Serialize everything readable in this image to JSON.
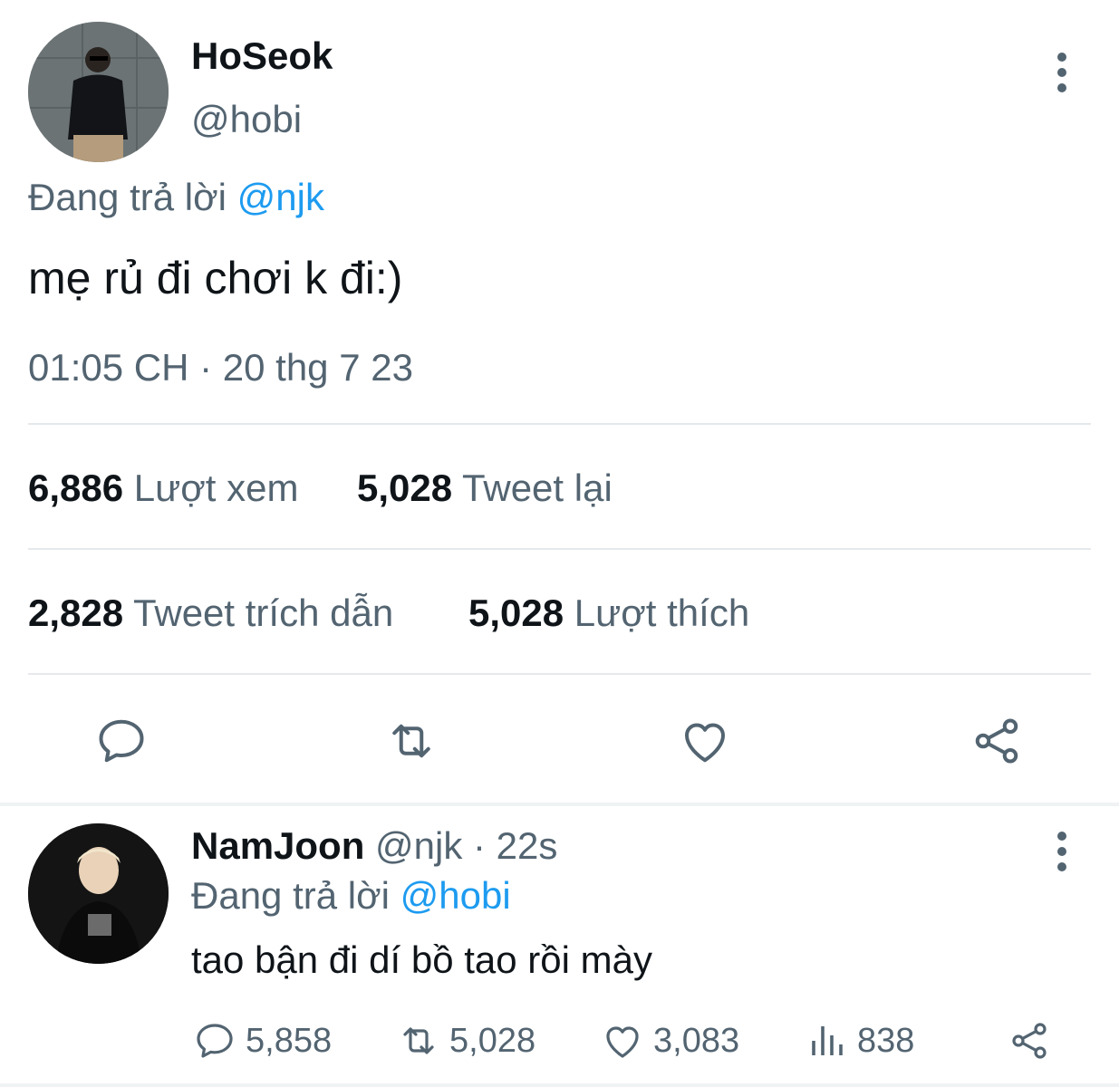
{
  "main_tweet": {
    "name": "HoSeok",
    "handle": "@hobi",
    "replying_prefix": "Đang trả lời",
    "replying_to": "@njk",
    "text": "mẹ rủ đi chơi k đi:)",
    "timestamp": "01:05 CH · 20 thg 7 23",
    "stats": {
      "views_count": "6,886",
      "views_label": "Lượt xem",
      "retweets_count": "5,028",
      "retweets_label": "Tweet lại",
      "quotes_count": "2,828",
      "quotes_label": "Tweet trích dẫn",
      "likes_count": "5,028",
      "likes_label": "Lượt thích"
    },
    "actions": [
      "reply-icon",
      "retweet-icon",
      "like-icon",
      "share-icon"
    ]
  },
  "reply_tweet": {
    "name": "NamJoon",
    "handle": "@njk",
    "time": "· 22s",
    "replying_prefix": "Đang trả lời",
    "replying_to": "@hobi",
    "text": "tao bận đi dí bồ tao rồi mày",
    "counts": {
      "replies": "5,858",
      "retweets": "5,028",
      "likes": "3,083",
      "views": "838"
    }
  },
  "colors": {
    "text": "#0f1419",
    "muted": "#536471",
    "link": "#1d9bf0",
    "divider": "#e6e9ec"
  }
}
